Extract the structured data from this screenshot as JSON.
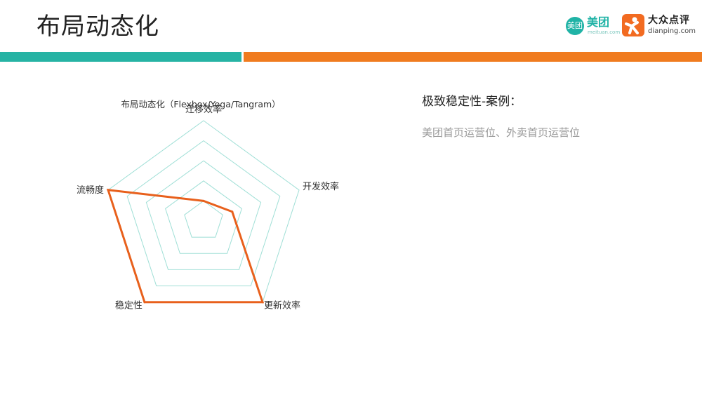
{
  "slide": {
    "title": "布局动态化",
    "colors": {
      "teal": "#26b3a4",
      "orange": "#f07b1f",
      "radar_line": "#e8601c",
      "grid": "#9fdfd6"
    }
  },
  "logos": {
    "meituan": {
      "circle_text": "美团",
      "word": "美团",
      "sub": "meituan.com",
      "color": "#20b3a6"
    },
    "dianping": {
      "text_cn": "大众点评",
      "text_en": "dianping.com",
      "color": "#f26b21"
    }
  },
  "side": {
    "heading": "极致稳定性-案例：",
    "text": "美团首页运营位、外卖首页运营位"
  },
  "chart_data": {
    "type": "radar",
    "title": "布局动态化（Flexbox/Yoga/Tangram）",
    "indicators": [
      "迁移效率",
      "开发效率",
      "更新效率",
      "稳定性",
      "流畅度"
    ],
    "max": 5,
    "rings": 5,
    "series": [
      {
        "values": [
          1,
          1.5,
          5,
          5,
          5
        ]
      }
    ]
  }
}
